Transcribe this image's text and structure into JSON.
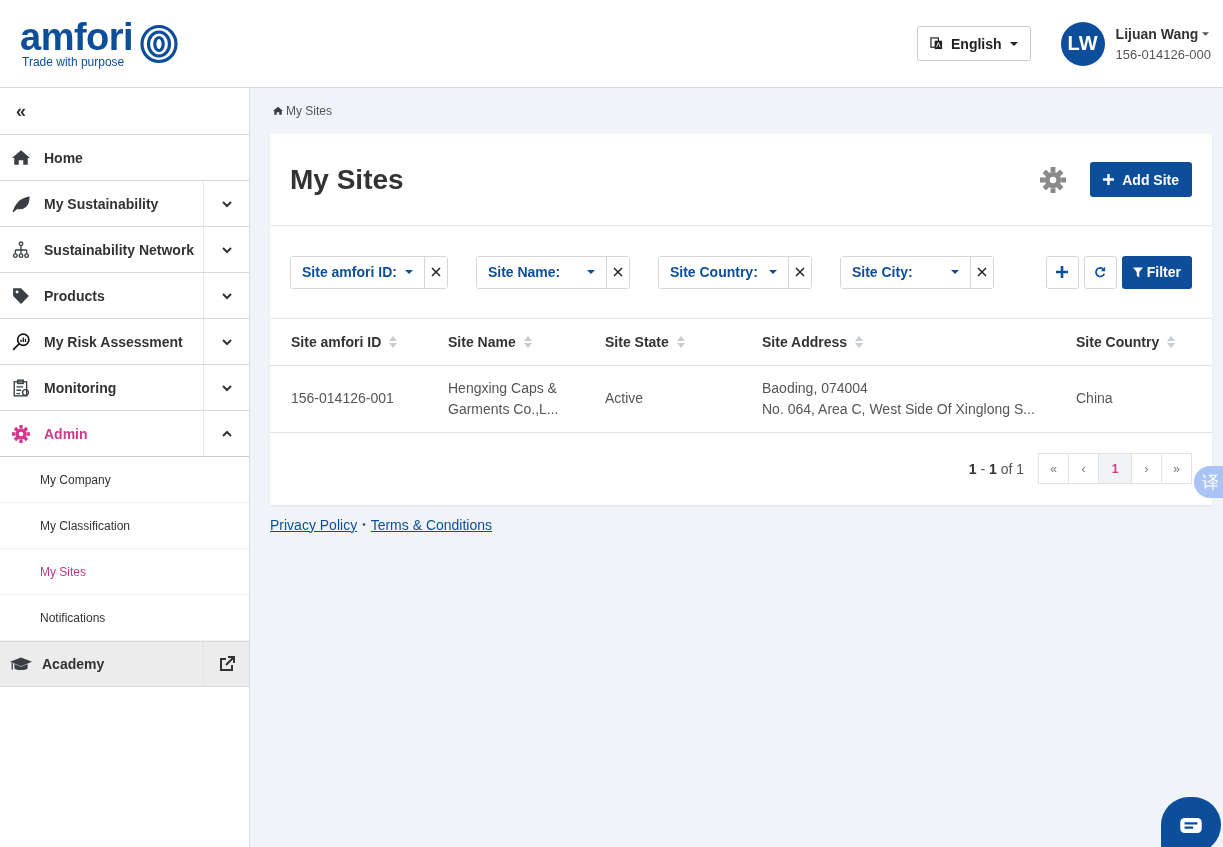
{
  "header": {
    "logo": {
      "name": "amfori",
      "tagline": "Trade with purpose"
    },
    "language": {
      "label": "English"
    },
    "user": {
      "initials": "LW",
      "name": "Lijuan Wang",
      "account_id": "156-014126-000"
    }
  },
  "sidebar": {
    "collapse": "«",
    "items": [
      {
        "label": "Home",
        "expandable": false,
        "expanded": false,
        "selected": false
      },
      {
        "label": "My Sustainability",
        "expandable": true,
        "expanded": false,
        "selected": false
      },
      {
        "label": "Sustainability Network",
        "expandable": true,
        "expanded": false,
        "selected": false
      },
      {
        "label": "Products",
        "expandable": true,
        "expanded": false,
        "selected": false
      },
      {
        "label": "My Risk Assessment",
        "expandable": true,
        "expanded": false,
        "selected": false
      },
      {
        "label": "Monitoring",
        "expandable": true,
        "expanded": false,
        "selected": false
      },
      {
        "label": "Admin",
        "expandable": true,
        "expanded": true,
        "selected": true,
        "children": [
          {
            "label": "My Company",
            "selected": false
          },
          {
            "label": "My Classification",
            "selected": false
          },
          {
            "label": "My Sites",
            "selected": true
          },
          {
            "label": "Notifications",
            "selected": false
          }
        ]
      }
    ],
    "academy": {
      "label": "Academy"
    }
  },
  "breadcrumb": "My Sites",
  "page": {
    "title": "My Sites",
    "add_button": "Add Site",
    "filters": [
      {
        "label": "Site amfori ID:"
      },
      {
        "label": "Site Name:"
      },
      {
        "label": "Site Country:"
      },
      {
        "label": "Site City:"
      }
    ],
    "filter_button": "Filter",
    "table": {
      "columns": [
        "Site amfori ID",
        "Site Name",
        "Site State",
        "Site Address",
        "Site Country"
      ],
      "rows": [
        {
          "cells": [
            [
              "156-014126-001"
            ],
            [
              "Hengxing Caps &",
              "Garments Co.,L..."
            ],
            [
              "Active"
            ],
            [
              "Baoding, 074004",
              "No. 064, Area C, West Side Of Xinglong S..."
            ],
            [
              "China"
            ]
          ]
        }
      ]
    },
    "pagination": {
      "summary": "**1** - **1** of 1",
      "pages": [
        {
          "label": "«",
          "selected": false
        },
        {
          "label": "‹",
          "selected": false
        },
        {
          "label": "1",
          "selected": true
        },
        {
          "label": "›",
          "selected": false
        },
        {
          "label": "»",
          "selected": false
        }
      ]
    }
  },
  "footer": {
    "links": [
      "Privacy Policy",
      "Terms & Conditions"
    ],
    "separator": "•"
  },
  "translate_badge": "译"
}
